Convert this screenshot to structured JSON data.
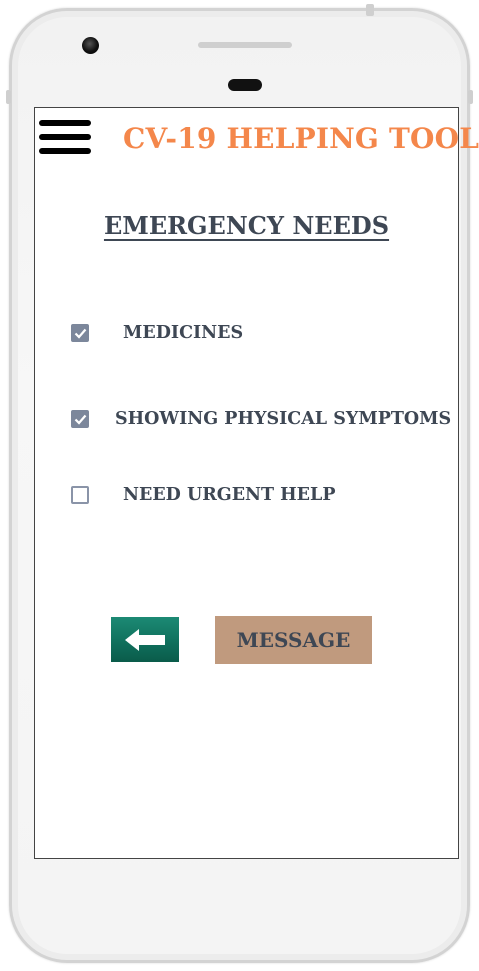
{
  "header": {
    "menu_icon": "hamburger-menu-icon",
    "title": "CV-19 HELPING TOOL"
  },
  "main": {
    "section_title": "EMERGENCY NEEDS",
    "options": [
      {
        "label": "MEDICINES",
        "checked": true
      },
      {
        "label": "SHOWING PHYSICAL SYMPTOMS",
        "checked": true
      },
      {
        "label": "NEED URGENT HELP",
        "checked": false
      }
    ]
  },
  "actions": {
    "back_icon": "arrow-left-icon",
    "message_label": "MESSAGE"
  },
  "colors": {
    "title": "#f4874b",
    "text": "#3e4754",
    "checkbox": "#7c879b",
    "back_button": "#0f6e5b",
    "message_button": "#c09a7e"
  }
}
